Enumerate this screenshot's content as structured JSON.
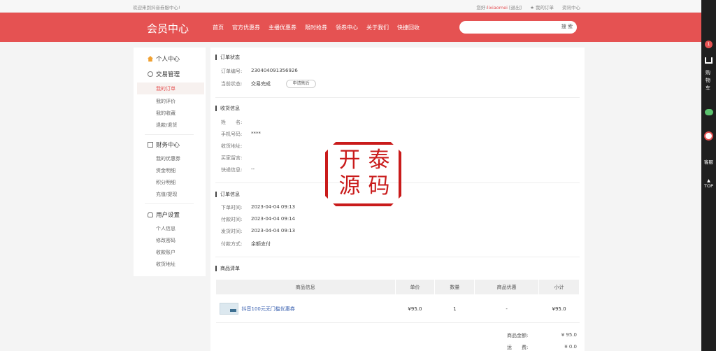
{
  "topbar": {
    "welcome": "欢迎来到抖音券服中心!",
    "greeting": "您好:",
    "username": "lixiaomei",
    "logout": "[退出]",
    "my_orders": "★ 我的订单",
    "news": "资讯中心"
  },
  "header": {
    "logo": "会员中心",
    "nav": [
      "首页",
      "官方优惠券",
      "主播优惠券",
      "限时抢券",
      "领券中心",
      "关于我们",
      "快捷回收"
    ],
    "search_placeholder": "",
    "search_button": "搜 索"
  },
  "sidebar": {
    "personal_center": "个人中心",
    "trade_title": "交易管理",
    "trade_items": [
      "我的订单",
      "我的评价",
      "我的收藏",
      "退款/退货"
    ],
    "finance_title": "财务中心",
    "finance_items": [
      "我的优惠券",
      "资金明细",
      "积分明细",
      "充值/提现"
    ],
    "user_title": "用户设置",
    "user_items": [
      "个人信息",
      "修改密码",
      "收款账户",
      "收货地址"
    ]
  },
  "order_status": {
    "title": "订单状态",
    "number_label": "订单编号:",
    "number": "230404091356926",
    "status_label": "当前状态:",
    "status": "交易完成",
    "after_sale_button": "申请售后"
  },
  "receiver": {
    "title": "收货信息",
    "rows": [
      {
        "label": "姓　　名:",
        "value": ""
      },
      {
        "label": "手机号码:",
        "value": "****"
      },
      {
        "label": "收货地址:",
        "value": ""
      },
      {
        "label": "买家留言:",
        "value": ""
      },
      {
        "label": "快递信息:",
        "value": "--"
      }
    ]
  },
  "order_info": {
    "title": "订单信息",
    "rows": [
      {
        "label": "下单时间:",
        "value": "2023-04-04 09:13"
      },
      {
        "label": "付款时间:",
        "value": "2023-04-04 09:14"
      },
      {
        "label": "发货时间:",
        "value": "2023-04-04 09:13"
      },
      {
        "label": "付款方式:",
        "value": "余额支付"
      }
    ]
  },
  "goods": {
    "title": "商品清单",
    "headers": [
      "商品信息",
      "单价",
      "数量",
      "商品优惠",
      "小计"
    ],
    "row": {
      "name": "抖音100元无门槛优惠券",
      "price": "¥95.0",
      "qty": "1",
      "discount": "-",
      "subtotal": "¥95.0"
    },
    "summary": [
      {
        "label": "商品金额:",
        "value": "¥ 95.0"
      },
      {
        "label": "运　　费:",
        "value": "¥ 0.0"
      }
    ]
  },
  "stamp": {
    "chars": [
      "开",
      "泰",
      "源",
      "码"
    ]
  },
  "rightbar": {
    "cart_count": "1",
    "cart_label": "购物车",
    "service_label": "客服",
    "top_label": "TOP"
  },
  "colors": {
    "brand_red": "#e55252",
    "status_green": "#2e8b3a",
    "stamp_red": "#c91b1b"
  }
}
